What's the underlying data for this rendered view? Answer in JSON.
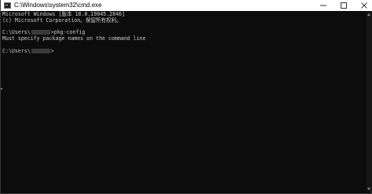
{
  "window": {
    "title": "C:\\Windows\\system32\\cmd.exe",
    "icon": "cmd-icon",
    "controls": [
      "minimize-icon",
      "maximize-icon",
      "close-icon"
    ]
  },
  "console": {
    "lines": [
      {
        "text": "Microsoft Windows [版本 10.0.19045.2846]"
      },
      {
        "text": "(c) Microsoft Corporation。保留所有权利。"
      },
      {
        "text": ""
      },
      {
        "prompt_prefix": "C:\\Users\\",
        "prompt_suffix": ">",
        "command": "pkg-config"
      },
      {
        "text": "Must specify package names on the command line"
      },
      {
        "text": ""
      },
      {
        "prompt_prefix": "C:\\Users\\",
        "prompt_suffix": ">",
        "command": ""
      }
    ]
  },
  "colors": {
    "background": "#0c0c0c",
    "text": "#cccccc",
    "titlebar": "#ffffff"
  }
}
